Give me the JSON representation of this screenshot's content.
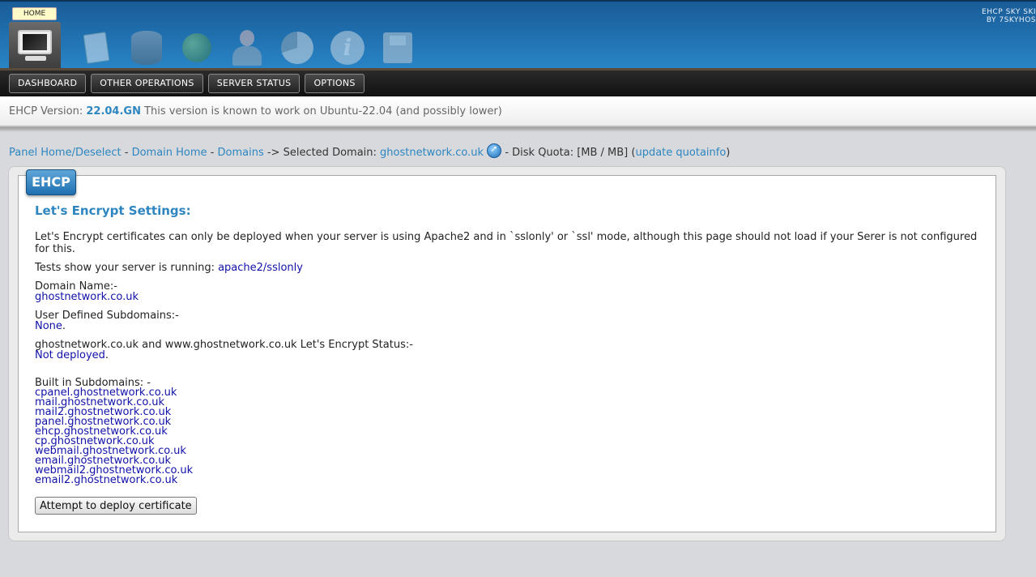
{
  "header": {
    "home_tooltip": "HOME",
    "brand_line1": "EHCP SKY SKI",
    "brand_line2": "BY 7SKYHOS",
    "nav_icons": [
      "monitor-icon",
      "document-icon",
      "database-icon",
      "ftp-icon",
      "user-icon",
      "pie-chart-icon",
      "info-icon",
      "save-icon"
    ]
  },
  "menu": {
    "items": [
      {
        "label": "DASHBOARD"
      },
      {
        "label": "OTHER OPERATIONS"
      },
      {
        "label": "SERVER STATUS"
      },
      {
        "label": "OPTIONS"
      }
    ]
  },
  "version": {
    "prefix": "EHCP Version: ",
    "number": "22.04.GN",
    "note": " This version is known to work on Ubuntu-22.04 (and possibly lower)"
  },
  "breadcrumb": {
    "panel_home": "Panel Home/Deselect",
    "sep1": " - ",
    "domain_home": "Domain Home",
    "sep2": " - ",
    "domains": "Domains",
    "selected_prefix": " -> Selected Domain: ",
    "selected_domain": "ghostnetwork.co.uk",
    "quota_text": " - Disk Quota: [MB / MB] (",
    "update_quota": "update quotainfo",
    "quota_close": ")"
  },
  "panel": {
    "tab_label": "EHCP",
    "title": "Let's Encrypt Settings:",
    "intro": "Let's Encrypt certificates can only be deployed when your server is using Apache2 and in `sslonly' or `ssl' mode, although this page should not load if your Serer is not configured for this.",
    "tests_label": "Tests show your server is running: ",
    "tests_value": "apache2/sslonly",
    "domain_label": "Domain Name:-",
    "domain_value": "ghostnetwork.co.uk",
    "subdomains_label": "User Defined Subdomains:-",
    "subdomains_value": "None",
    "status_label": "ghostnetwork.co.uk and www.ghostnetwork.co.uk Let's Encrypt Status:-",
    "status_value": "Not deployed",
    "builtin_label": "Built in Subdomains: -",
    "builtin": [
      "cpanel.ghostnetwork.co.uk",
      "mail.ghostnetwork.co.uk",
      "mail2.ghostnetwork.co.uk",
      "panel.ghostnetwork.co.uk",
      "ehcp.ghostnetwork.co.uk",
      "cp.ghostnetwork.co.uk",
      "webmail.ghostnetwork.co.uk",
      "email.ghostnetwork.co.uk",
      "webmail2.ghostnetwork.co.uk",
      "email2.ghostnetwork.co.uk"
    ],
    "deploy_button": "Attempt to deploy certificate"
  }
}
